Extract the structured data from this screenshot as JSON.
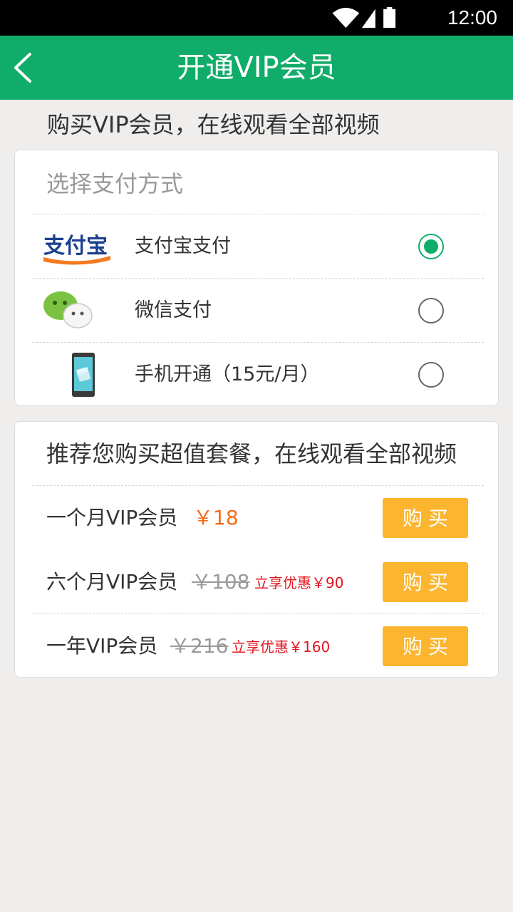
{
  "status_bar": {
    "time": "12:00"
  },
  "titlebar": {
    "title": "开通VIP会员"
  },
  "subtitle": "购买VIP会员，在线观看全部视频",
  "payment": {
    "header": "选择支付方式",
    "options": [
      {
        "label": "支付宝支付",
        "icon": "alipay-logo",
        "selected": true
      },
      {
        "label": "微信支付",
        "icon": "wechat-logo",
        "selected": false
      },
      {
        "label": "手机开通（15元/月）",
        "icon": "phone-icon",
        "selected": false
      }
    ]
  },
  "packages": {
    "header": "推荐您购买超值套餐，在线观看全部视频",
    "items": [
      {
        "name": "一个月VIP会员",
        "price": "￥18",
        "old_price": "",
        "promo": "",
        "buy_label": "购买"
      },
      {
        "name": "六个月VIP会员",
        "price": "",
        "old_price": "￥108",
        "promo": "立享优惠￥90",
        "buy_label": "购买"
      },
      {
        "name": "一年VIP会员",
        "price": "",
        "old_price": "￥216",
        "promo": "立享优惠￥160",
        "buy_label": "购买"
      }
    ]
  },
  "colors": {
    "brand": "#10ac6a",
    "buy_button": "#fbb52f",
    "price": "#f46a17",
    "promo": "#e3141e"
  },
  "alipay_logo_text": "支付宝"
}
